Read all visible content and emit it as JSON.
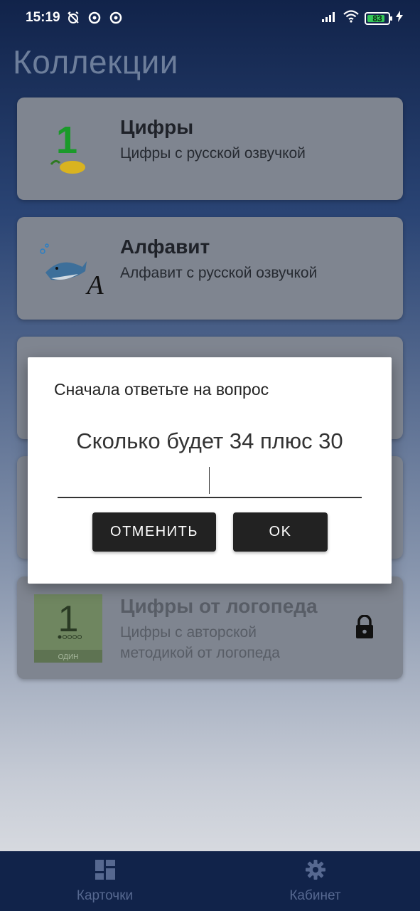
{
  "status_bar": {
    "time": "15:19",
    "battery": "83",
    "icons": [
      "alarm-off-icon",
      "data-saver-icon",
      "data-saver-icon",
      "signal-icon",
      "wifi-icon",
      "battery-icon",
      "charging-icon"
    ]
  },
  "page_title": "Коллекции",
  "collections": [
    {
      "title": "Цифры",
      "subtitle": "Цифры с русской озвучкой",
      "thumb": "1"
    },
    {
      "title": "Алфавит",
      "subtitle": "Алфавит с русской озвучкой",
      "thumb": "А"
    },
    {
      "title": "",
      "subtitle": ""
    },
    {
      "title": "",
      "subtitle": ""
    },
    {
      "title": "Цифры от логопеда",
      "subtitle_line1": "Цифры с авторской",
      "subtitle_line2": "методикой от логопеда",
      "thumb": "1",
      "thumb_caption": "ОДИН",
      "locked": true
    }
  ],
  "dialog": {
    "title": "Сначала ответьте на вопрос",
    "question": "Сколько будет 34 плюс 30",
    "input_value": "",
    "cancel_label": "ОТМЕНИТЬ",
    "ok_label": "OK"
  },
  "bottom_nav": {
    "items": [
      {
        "label": "Карточки",
        "icon": "dashboard-icon"
      },
      {
        "label": "Кабинет",
        "icon": "gear-icon"
      }
    ]
  },
  "colors": {
    "dark_blue": "#11234a",
    "card_dim": "#7f8590",
    "button_dark": "#222222",
    "digit_green": "#1a9a2a"
  }
}
